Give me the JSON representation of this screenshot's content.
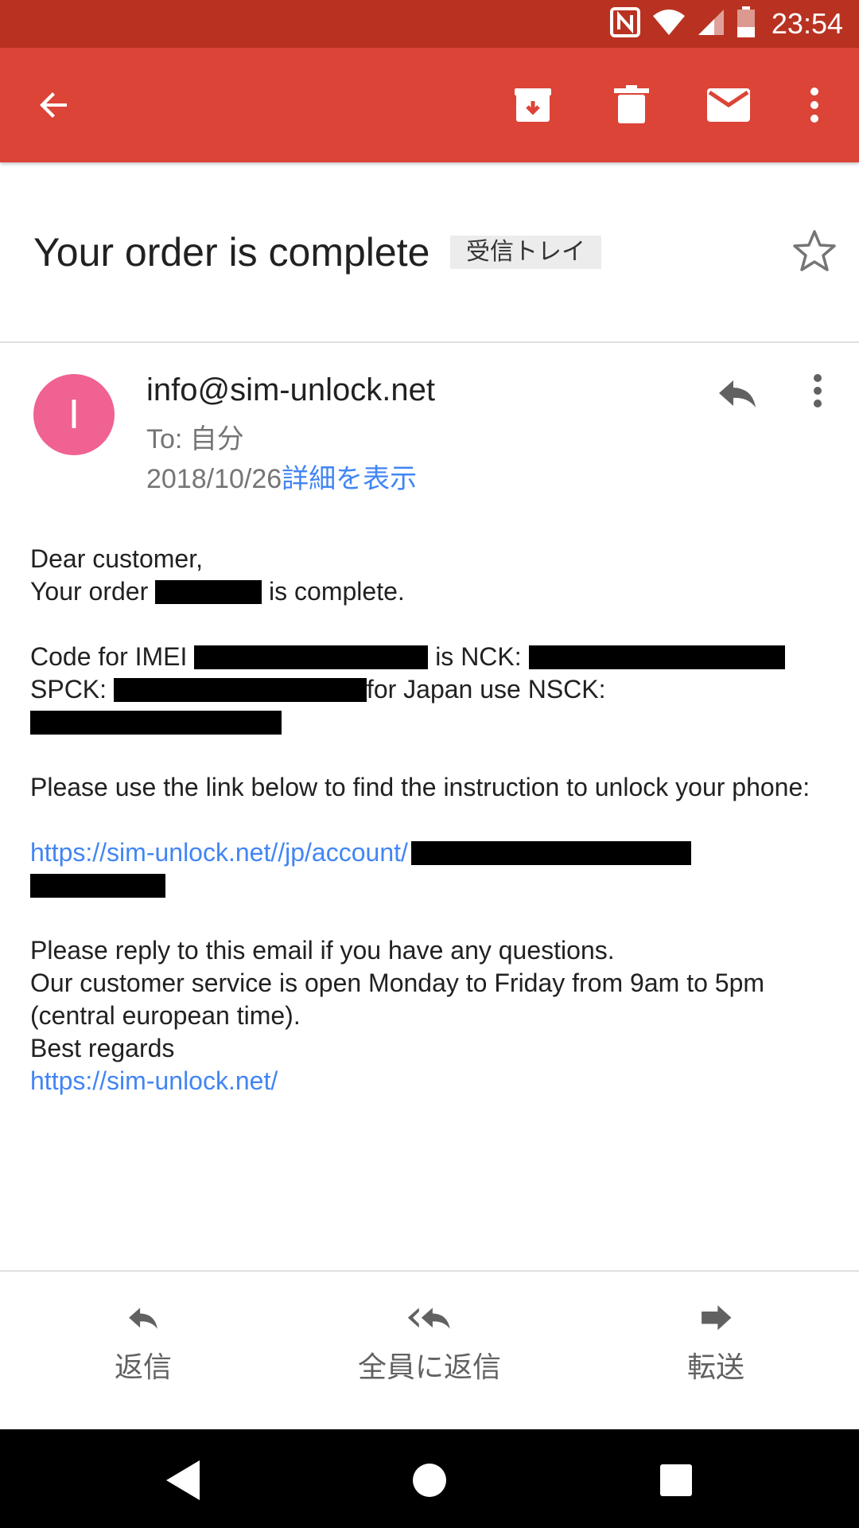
{
  "status_bar": {
    "time": "23:54"
  },
  "toolbar": {
    "back_icon": "arrow-back-icon",
    "archive_icon": "archive-icon",
    "delete_icon": "delete-icon",
    "mark_unread_icon": "mail-icon",
    "more_icon": "more-vert-icon"
  },
  "email": {
    "subject": "Your order is complete",
    "label": "受信トレイ",
    "avatar_letter": "I",
    "sender": "info@sim-unlock.net",
    "to": "To: 自分",
    "date": "2018/10/26",
    "details_link": "詳細を表示",
    "body": {
      "greeting": "Dear customer,",
      "order_prefix": "Your order",
      "order_suffix": "is complete.",
      "imei_prefix": "Code for IMEI",
      "nck_label": "is NCK:",
      "spck_label": "SPCK:",
      "nsck_label": "for Japan use NSCK:",
      "instructions": "Please use the link below to find the instruction to unlock your phone:",
      "account_link": "https://sim-unlock.net//jp/account/",
      "reply_line": "Please reply to this email if you have any questions.",
      "service_line": "Our customer service is open Monday to Friday from 9am to 5pm (central european time).",
      "regards": "Best regards",
      "site_link": "https://sim-unlock.net/"
    }
  },
  "actions": {
    "reply": "返信",
    "reply_all": "全員に返信",
    "forward": "転送"
  },
  "colors": {
    "status_bar": "#b93221",
    "toolbar": "#db4437",
    "avatar": "#f06292",
    "link": "#4285f4"
  }
}
